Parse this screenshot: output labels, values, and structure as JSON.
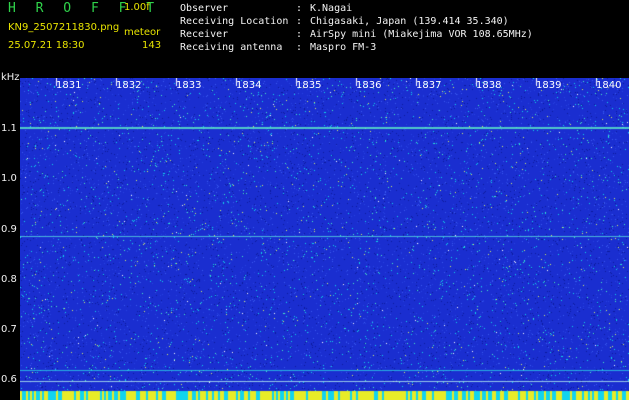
{
  "header": {
    "title": "H R O F F T",
    "version": "1.00f",
    "filename": "KN9_2507211830.png",
    "mode_label": "meteor",
    "datetime": "25.07.21 18:30",
    "count": "143"
  },
  "meta": [
    {
      "key": "Observer",
      "value": "K.Nagai"
    },
    {
      "key": "Receiving Location",
      "value": "Chigasaki, Japan (139.414 35.340)"
    },
    {
      "key": "Receiver",
      "value": "AirSpy mini (Miakejima VOR 108.65MHz)"
    },
    {
      "key": "Receiving antenna",
      "value": "Maspro FM-3"
    }
  ],
  "axis": {
    "unit": "kHz",
    "y_ticks": [
      "1.1",
      "1.0",
      "0.9",
      "0.8",
      "0.7",
      "0.6"
    ],
    "time_labels": [
      "1831",
      "1832",
      "1833",
      "1834",
      "1835",
      "1836",
      "1837",
      "1838",
      "1839",
      "1840"
    ]
  },
  "colors": {
    "background": "#000000",
    "plot": "#1a2ed0",
    "title": "#2fd24a",
    "accent": "#e8e400"
  }
}
